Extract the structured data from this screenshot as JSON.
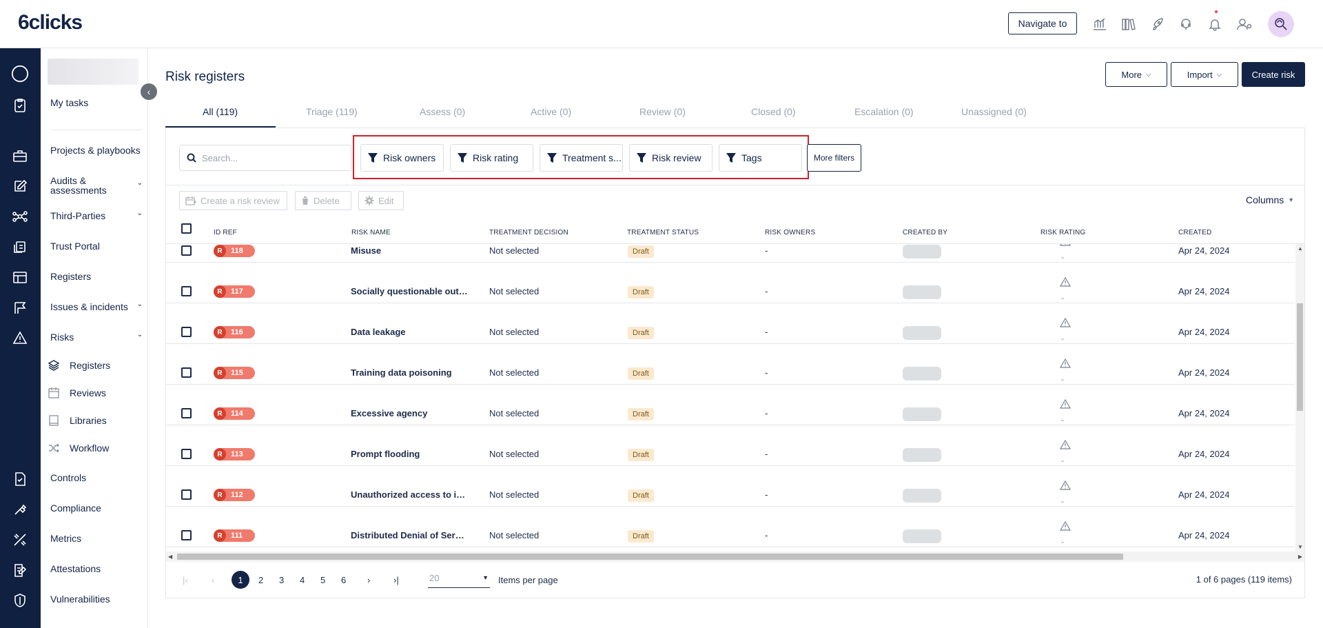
{
  "header": {
    "logo": "6clicks",
    "navigate_label": "Navigate to",
    "icons": [
      "analytics-icon",
      "library-icon",
      "rocket-icon",
      "support-icon",
      "bell-icon",
      "user-settings-icon",
      "search-profile-icon"
    ]
  },
  "sidebar": {
    "items": [
      {
        "label": "My tasks"
      },
      {
        "label": "Projects & playbooks"
      },
      {
        "label": "Audits & assessments"
      },
      {
        "label": "Third-Parties"
      },
      {
        "label": "Trust Portal"
      },
      {
        "label": "Registers"
      },
      {
        "label": "Issues & incidents"
      },
      {
        "label": "Risks"
      },
      {
        "label": "Controls"
      },
      {
        "label": "Compliance"
      },
      {
        "label": "Metrics"
      },
      {
        "label": "Attestations"
      },
      {
        "label": "Vulnerabilities"
      }
    ],
    "risk_subitems": [
      {
        "label": "Registers"
      },
      {
        "label": "Reviews"
      },
      {
        "label": "Libraries"
      },
      {
        "label": "Workflow"
      }
    ]
  },
  "page": {
    "title": "Risk registers",
    "buttons": {
      "more": "More",
      "import": "Import",
      "create": "Create risk"
    },
    "tabs": [
      {
        "label": "All (119)"
      },
      {
        "label": "Triage (119)"
      },
      {
        "label": "Assess (0)"
      },
      {
        "label": "Active (0)"
      },
      {
        "label": "Review (0)"
      },
      {
        "label": "Closed (0)"
      },
      {
        "label": "Escalation (0)"
      },
      {
        "label": "Unassigned (0)"
      }
    ]
  },
  "filters": {
    "search_placeholder": "Search...",
    "buttons": [
      "Risk owners",
      "Risk rating",
      "Treatment s...",
      "Risk review",
      "Tags"
    ],
    "more_filters": "More filters"
  },
  "toolbar": {
    "create_review": "Create a risk review",
    "delete": "Delete",
    "edit": "Edit",
    "columns": "Columns"
  },
  "table": {
    "columns": [
      "ID REF",
      "RISK NAME",
      "TREATMENT DECISION",
      "TREATMENT STATUS",
      "RISK OWNERS",
      "CREATED BY",
      "RISK RATING",
      "CREATED"
    ],
    "rows": [
      {
        "badge": "R",
        "id": "118",
        "name": "Misuse",
        "decision": "Not selected",
        "status": "Draft",
        "owners": "-",
        "rating": "-",
        "created": "Apr 24, 2024"
      },
      {
        "badge": "R",
        "id": "117",
        "name": "Socially questionable outco...",
        "decision": "Not selected",
        "status": "Draft",
        "owners": "-",
        "rating": "-",
        "created": "Apr 24, 2024"
      },
      {
        "badge": "R",
        "id": "116",
        "name": "Data leakage",
        "decision": "Not selected",
        "status": "Draft",
        "owners": "-",
        "rating": "-",
        "created": "Apr 24, 2024"
      },
      {
        "badge": "R",
        "id": "115",
        "name": "Training data poisoning",
        "decision": "Not selected",
        "status": "Draft",
        "owners": "-",
        "rating": "-",
        "created": "Apr 24, 2024"
      },
      {
        "badge": "R",
        "id": "114",
        "name": "Excessive agency",
        "decision": "Not selected",
        "status": "Draft",
        "owners": "-",
        "rating": "-",
        "created": "Apr 24, 2024"
      },
      {
        "badge": "R",
        "id": "113",
        "name": "Prompt flooding",
        "decision": "Not selected",
        "status": "Draft",
        "owners": "-",
        "rating": "-",
        "created": "Apr 24, 2024"
      },
      {
        "badge": "R",
        "id": "112",
        "name": "Unauthorized access to infr...",
        "decision": "Not selected",
        "status": "Draft",
        "owners": "-",
        "rating": "-",
        "created": "Apr 24, 2024"
      },
      {
        "badge": "R",
        "id": "111",
        "name": "Distributed Denial of Servic...",
        "decision": "Not selected",
        "status": "Draft",
        "owners": "-",
        "rating": "-",
        "created": "Apr 24, 2024"
      }
    ]
  },
  "pagination": {
    "pages": [
      "1",
      "2",
      "3",
      "4",
      "5",
      "6"
    ],
    "current": "1",
    "items_per_page_value": "20",
    "items_per_page_label": "Items per page",
    "info": "1 of 6 pages (119 items)"
  },
  "colors": {
    "navy": "#132447",
    "rail": "#0f2040",
    "highlight_box": "#d21f2a",
    "badge_red": "#d6402e",
    "draft_bg": "#fbe9cf"
  }
}
